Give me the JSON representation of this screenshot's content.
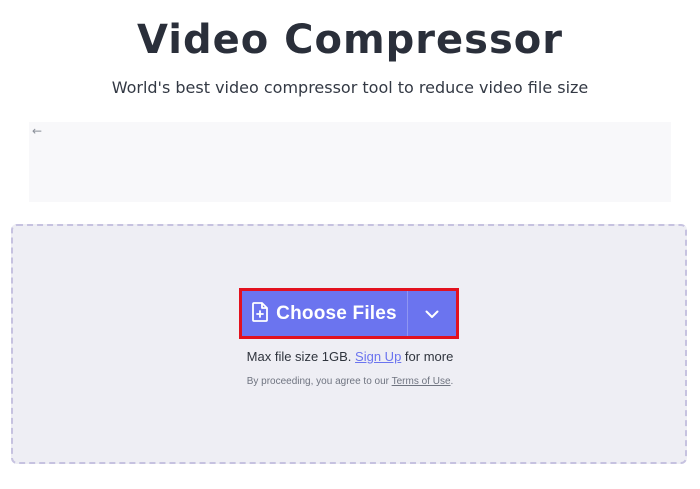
{
  "header": {
    "title": "Video Compressor",
    "subtitle": "World's best video compressor tool to reduce video file size"
  },
  "ad": {
    "back_arrow": "←"
  },
  "upload": {
    "choose_label": "Choose Files",
    "max_size_prefix": "Max file size 1GB.",
    "signup_label": "Sign Up",
    "max_size_suffix": "for more",
    "terms_prefix": "By proceeding, you agree to our",
    "terms_link": "Terms of Use",
    "terms_suffix": "."
  },
  "icons": {
    "file_add": "file-plus-icon",
    "dropdown": "chevron-down-icon"
  },
  "colors": {
    "accent": "#6b74ef",
    "highlight": "#e2111e",
    "dropzone_bg": "#eeeef4",
    "title_text": "#2a2f3a"
  }
}
